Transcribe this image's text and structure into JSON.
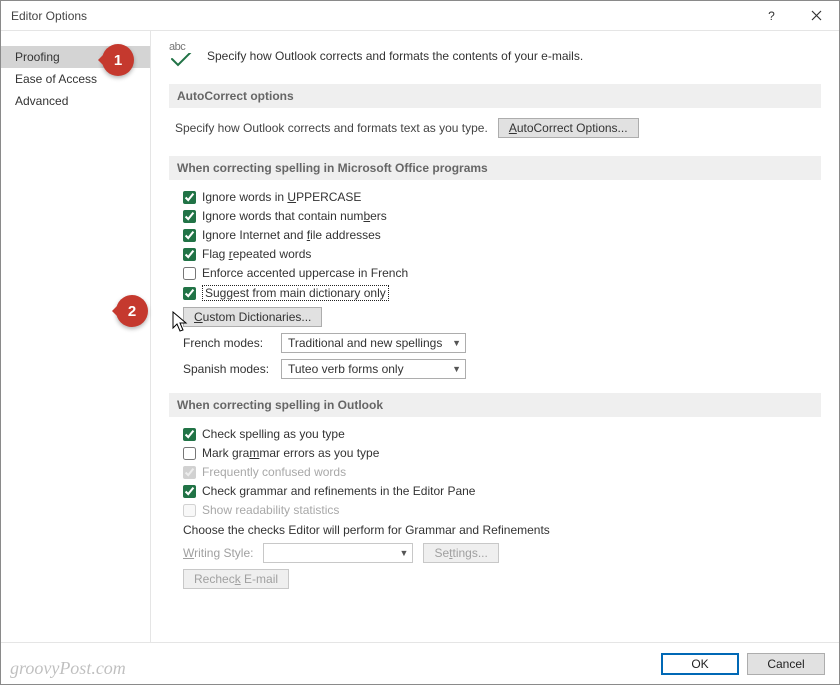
{
  "window": {
    "title": "Editor Options"
  },
  "sidebar": {
    "items": [
      {
        "label": "Proofing",
        "selected": true
      },
      {
        "label": "Ease of Access",
        "selected": false
      },
      {
        "label": "Advanced",
        "selected": false
      }
    ]
  },
  "intro": {
    "icon_text": "abc",
    "description": "Specify how Outlook corrects and formats the contents of your e-mails."
  },
  "sections": {
    "autocorrect": {
      "header": "AutoCorrect options",
      "text_before": "Specify how Outlook corrects and formats text as you type.",
      "button": "AutoCorrect Options..."
    },
    "office_spelling": {
      "header": "When correcting spelling in Microsoft Office programs",
      "options": [
        {
          "label": "Ignore words in UPPERCASE",
          "checked": true
        },
        {
          "label": "Ignore words that contain numbers",
          "checked": true
        },
        {
          "label": "Ignore Internet and file addresses",
          "checked": true
        },
        {
          "label": "Flag repeated words",
          "checked": true
        },
        {
          "label": "Enforce accented uppercase in French",
          "checked": false
        },
        {
          "label": "Suggest from main dictionary only",
          "checked": true,
          "focus": true
        }
      ],
      "custom_dict_button": "Custom Dictionaries...",
      "french_label": "French modes:",
      "french_value": "Traditional and new spellings",
      "spanish_label": "Spanish modes:",
      "spanish_value": "Tuteo verb forms only"
    },
    "outlook_spelling": {
      "header": "When correcting spelling in Outlook",
      "options": [
        {
          "label": "Check spelling as you type",
          "checked": true,
          "disabled": false
        },
        {
          "label": "Mark grammar errors as you type",
          "checked": false,
          "disabled": false
        },
        {
          "label": "Frequently confused words",
          "checked": true,
          "disabled": true
        },
        {
          "label": "Check grammar and refinements in the Editor Pane",
          "checked": true,
          "disabled": false
        },
        {
          "label": "Show readability statistics",
          "checked": false,
          "disabled": true
        }
      ],
      "note": "Choose the checks Editor will perform for Grammar and Refinements",
      "writing_style_label": "Writing Style:",
      "writing_style_value": "",
      "settings_button": "Settings...",
      "recheck_button": "Recheck E-mail"
    }
  },
  "footer": {
    "ok": "OK",
    "cancel": "Cancel"
  },
  "callouts": {
    "one": "1",
    "two": "2"
  },
  "watermark": "groovyPost.com"
}
